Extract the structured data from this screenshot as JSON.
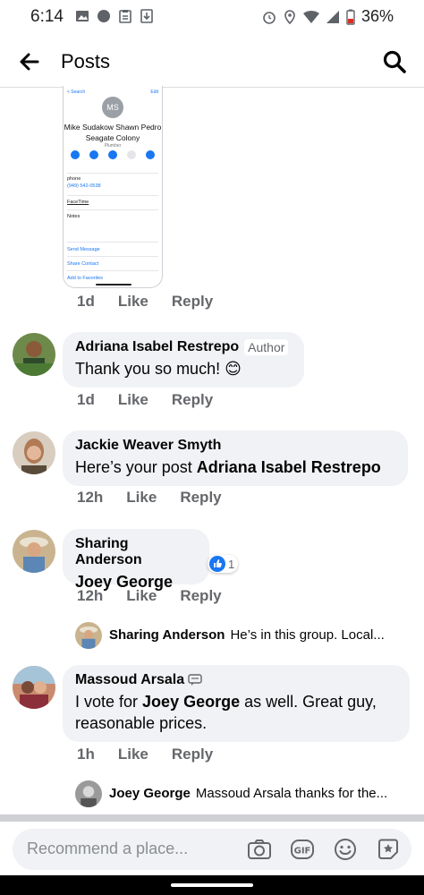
{
  "status_bar": {
    "time": "6:14",
    "battery": "36%"
  },
  "header": {
    "title": "Posts"
  },
  "screenshot_image": {
    "top_left": "< Search",
    "top_right": "Edit",
    "initials": "MS",
    "contact_name": "Mike Sudakow Shawn Pedro Seagate Colony",
    "contact_sub": "Plumber",
    "phone_label": "phone",
    "phone_number": "(949) 542-0538",
    "facetime": "FaceTime",
    "notes": "Notes",
    "send_message": "Send Message",
    "share_contact": "Share Contact",
    "add_favorites": "Add to Favorites"
  },
  "comments": [
    {
      "time": "1d",
      "like": "Like",
      "reply": "Reply"
    },
    {
      "name": "Adriana Isabel Restrepo",
      "badge": "Author",
      "text": "Thank you so much! 😊",
      "time": "1d",
      "like": "Like",
      "reply": "Reply"
    },
    {
      "name": "Jackie Weaver Smyth",
      "text_pre": "Here’s your post ",
      "text_bold": "Adriana Isabel Restrepo",
      "time": "12h",
      "like": "Like",
      "reply": "Reply"
    },
    {
      "name": "Sharing Anderson",
      "text_bold": "Joey George",
      "reaction_count": "1",
      "time": "12h",
      "like": "Like",
      "reply": "Reply",
      "reply_preview": {
        "name": "Sharing Anderson",
        "text": "He’s in this group. Local..."
      }
    },
    {
      "name": "Massoud Arsala",
      "text_pre": "I vote for ",
      "text_bold": "Joey George",
      "text_post": " as well. Great guy, reasonable prices.",
      "time": "1h",
      "like": "Like",
      "reply": "Reply",
      "reply_preview": {
        "name": "Joey George",
        "text": "Massoud Arsala thanks for the..."
      }
    }
  ],
  "composer": {
    "placeholder": "Recommend a place..."
  },
  "colors": {
    "bubble": "#f0f2f5",
    "meta": "#65676b",
    "accent": "#1877f2"
  }
}
